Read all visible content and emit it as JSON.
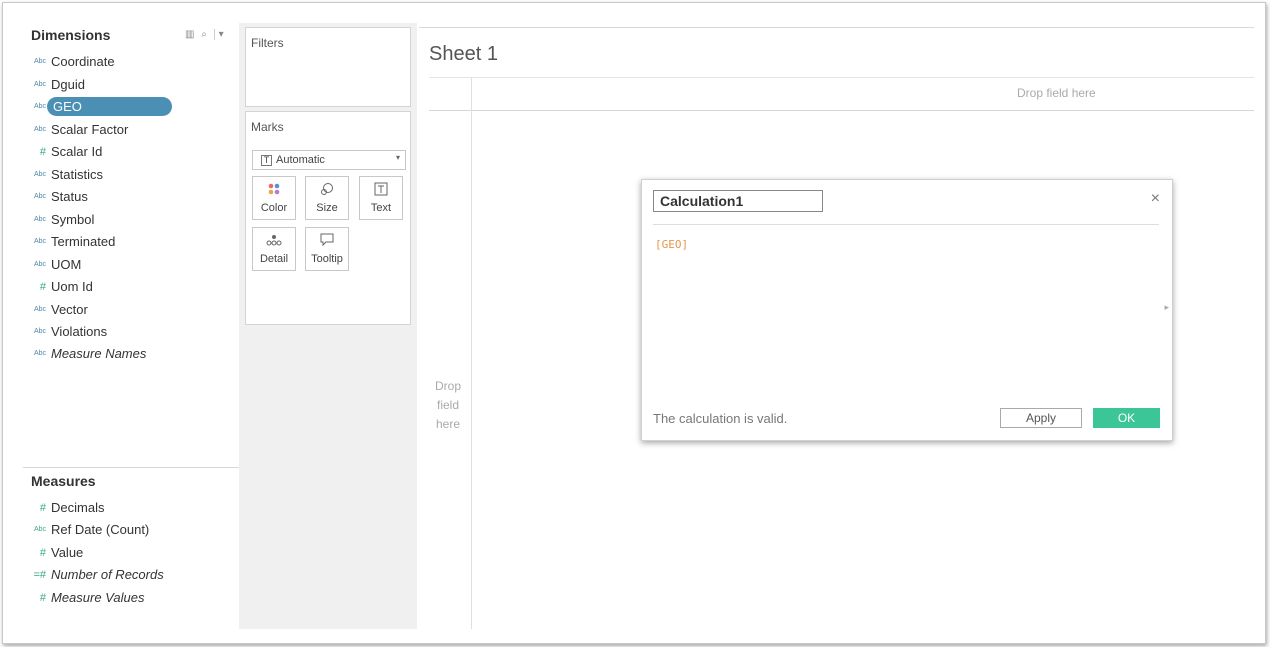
{
  "dimensions": {
    "title": "Dimensions",
    "fields": [
      {
        "type": "Abc",
        "name": "Coordinate"
      },
      {
        "type": "Abc",
        "name": "Dguid"
      },
      {
        "type": "Abc",
        "name": "GEO"
      },
      {
        "type": "Abc",
        "name": "Scalar Factor"
      },
      {
        "type": "#",
        "name": "Scalar Id"
      },
      {
        "type": "Abc",
        "name": "Statistics"
      },
      {
        "type": "Abc",
        "name": "Status"
      },
      {
        "type": "Abc",
        "name": "Symbol"
      },
      {
        "type": "Abc",
        "name": "Terminated"
      },
      {
        "type": "Abc",
        "name": "UOM"
      },
      {
        "type": "#",
        "name": "Uom Id"
      },
      {
        "type": "Abc",
        "name": "Vector"
      },
      {
        "type": "Abc",
        "name": "Violations"
      },
      {
        "type": "Abc",
        "name": "Measure Names"
      }
    ]
  },
  "measures": {
    "title": "Measures",
    "fields": [
      {
        "type": "#",
        "name": "Decimals"
      },
      {
        "type": "Abc",
        "name": "Ref Date (Count)"
      },
      {
        "type": "#",
        "name": "Value"
      },
      {
        "type": "=#",
        "name": "Number of Records"
      },
      {
        "type": "#",
        "name": "Measure Values"
      }
    ]
  },
  "filters": {
    "title": "Filters"
  },
  "marks": {
    "title": "Marks",
    "type_dropdown": "Automatic",
    "buttons": {
      "color": "Color",
      "size": "Size",
      "text": "Text",
      "detail": "Detail",
      "tooltip": "Tooltip"
    }
  },
  "sheet": {
    "title": "Sheet 1",
    "drop_columns": "Drop field here",
    "drop_rows": [
      "Drop",
      "field",
      "here"
    ]
  },
  "calc_dialog": {
    "name": "Calculation1",
    "formula": "[GEO]",
    "status": "The calculation is valid.",
    "apply_label": "Apply",
    "ok_label": "OK",
    "close_glyph": "×"
  },
  "colors": {
    "selected_field": "#4b90b4",
    "ok_button": "#3cc596",
    "formula_text": "#e8944a"
  }
}
